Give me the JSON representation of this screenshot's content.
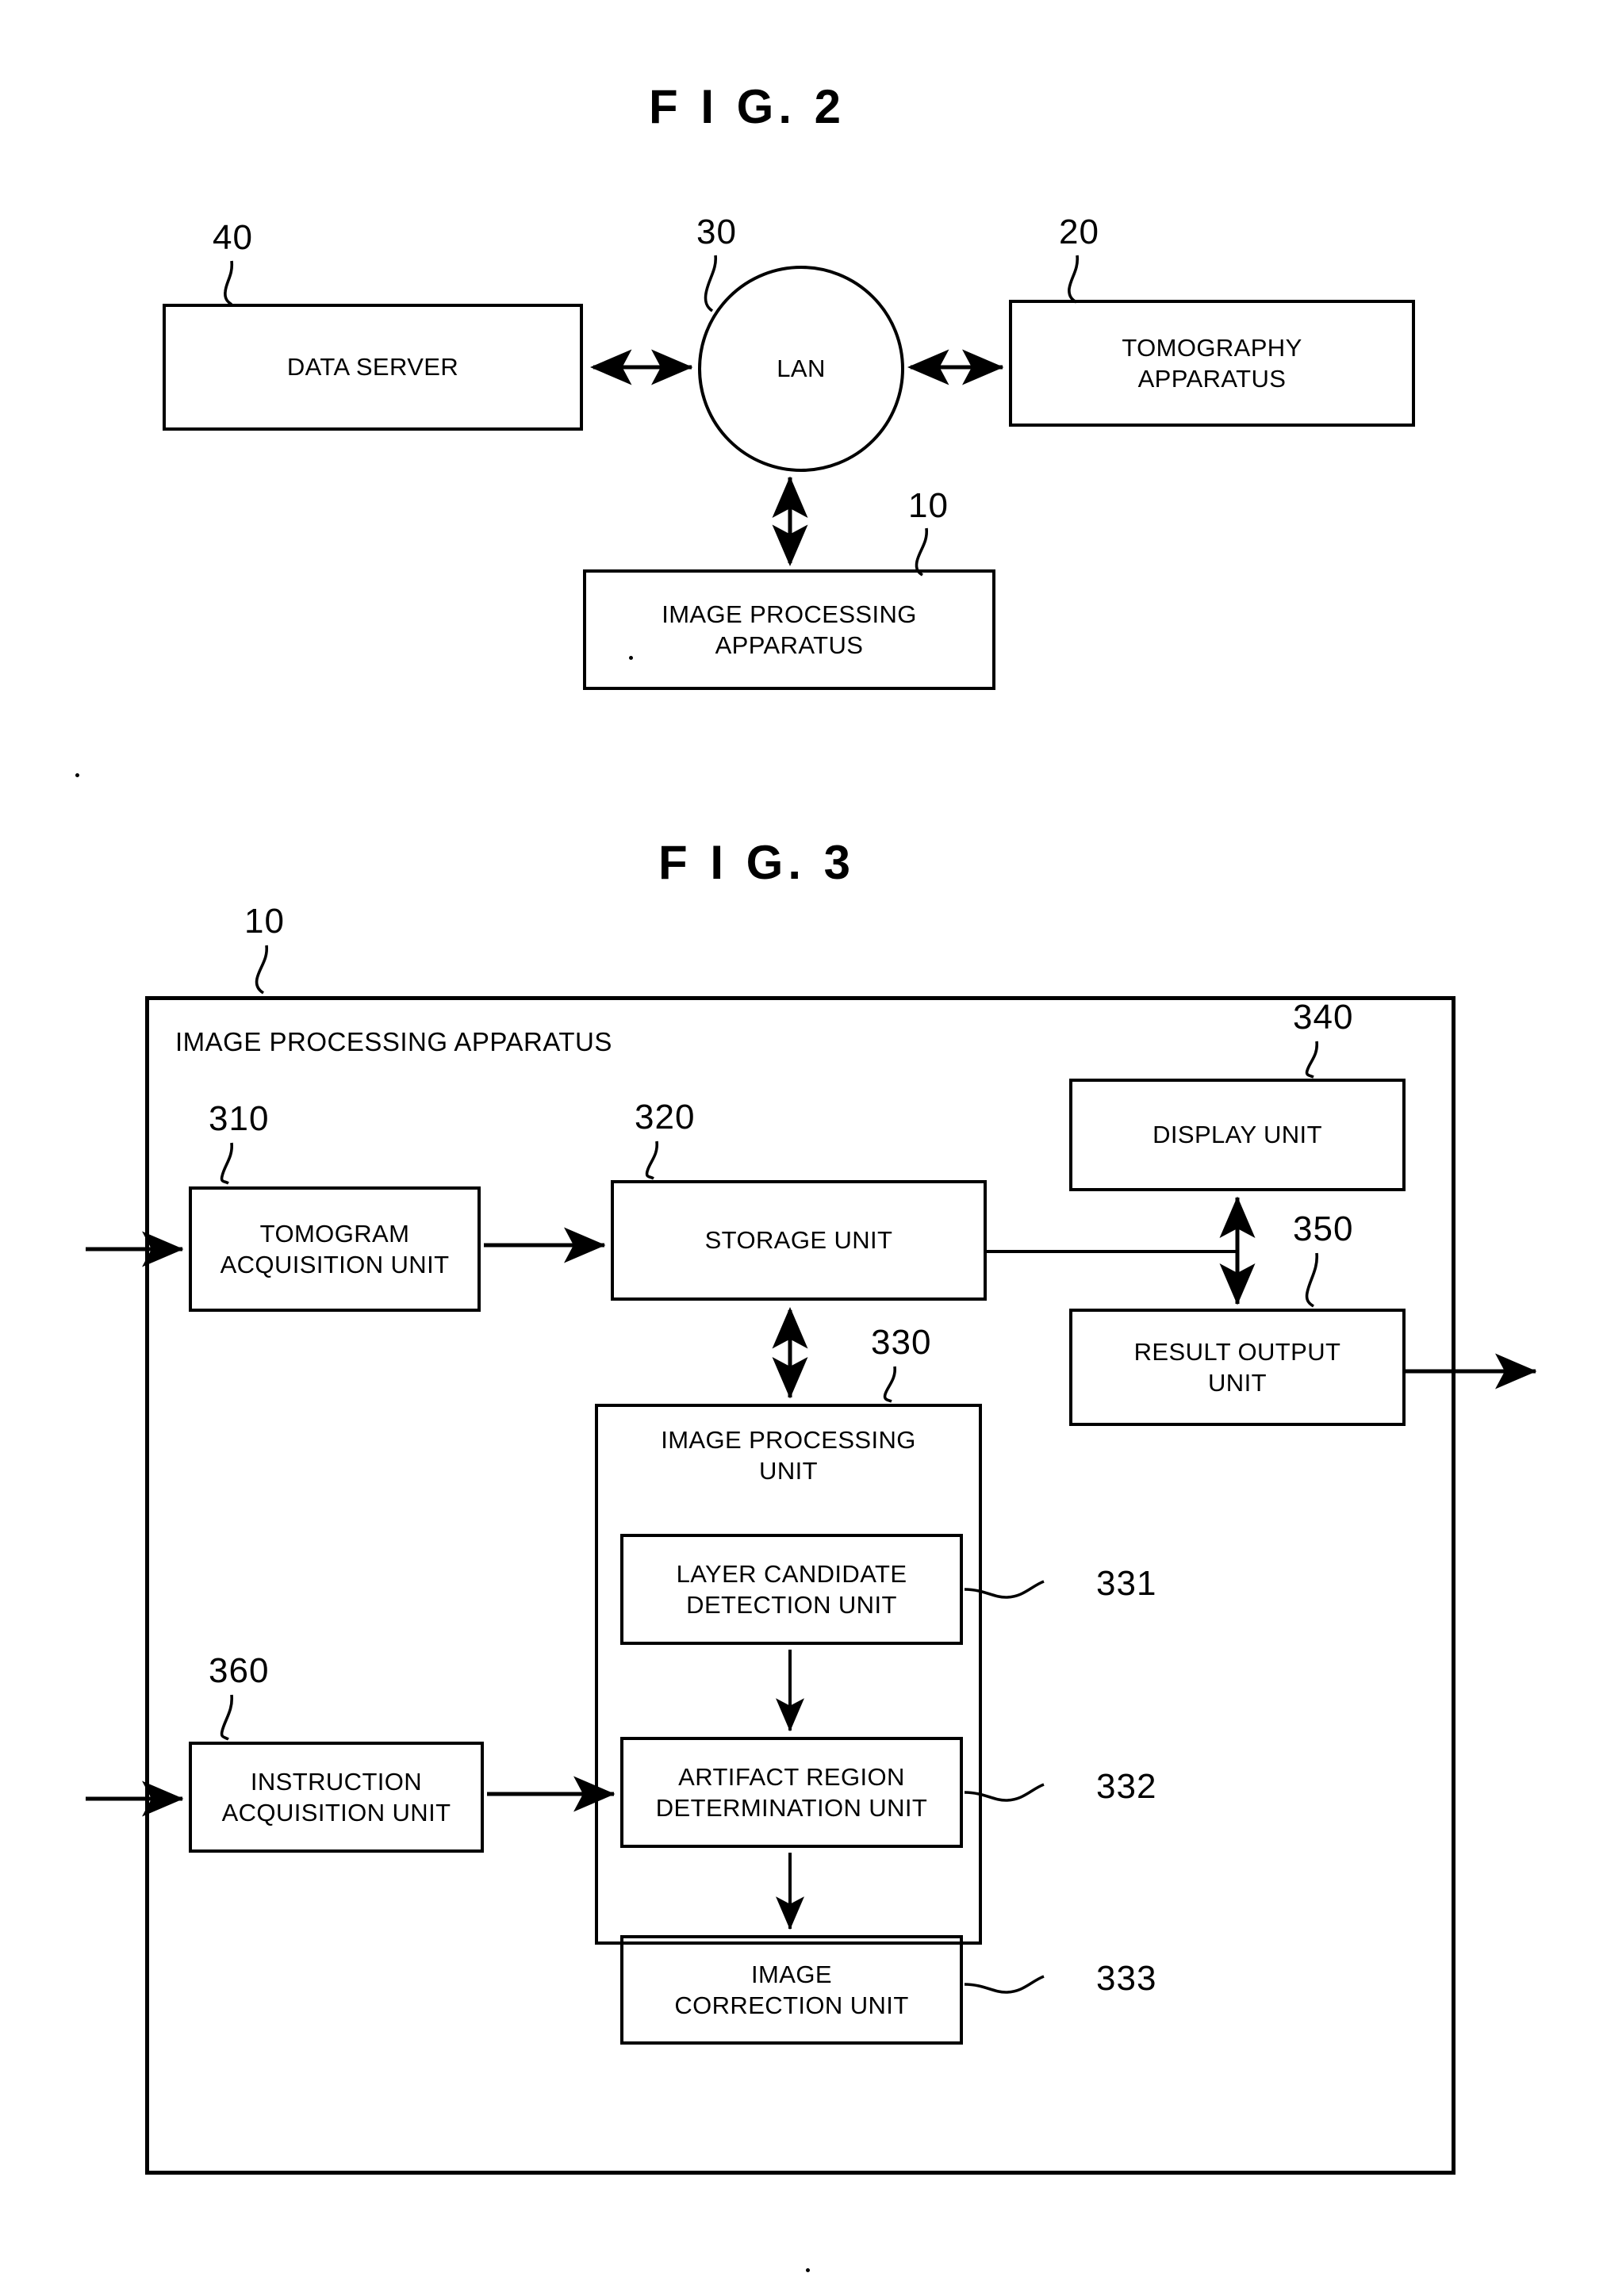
{
  "figures": [
    {
      "id": "fig2",
      "title": "F I G.  2",
      "nodes": [
        {
          "key": "data_server",
          "label": "DATA SERVER",
          "ref": "40"
        },
        {
          "key": "lan",
          "label": "LAN",
          "ref": "30"
        },
        {
          "key": "tomography",
          "label": "TOMOGRAPHY\nAPPARATUS",
          "ref": "20"
        },
        {
          "key": "image_proc",
          "label": "IMAGE PROCESSING\nAPPARATUS",
          "ref": "10"
        }
      ],
      "connections": [
        {
          "from": "data_server",
          "to": "lan",
          "arrow": "double"
        },
        {
          "from": "lan",
          "to": "tomography",
          "arrow": "double"
        },
        {
          "from": "image_proc",
          "to": "lan",
          "arrow": "double"
        }
      ]
    },
    {
      "id": "fig3",
      "title": "F I G.  3",
      "container": {
        "label": "IMAGE PROCESSING APPARATUS",
        "ref": "10"
      },
      "nodes": [
        {
          "key": "tomogram_acq",
          "label": "TOMOGRAM\nACQUISITION UNIT",
          "ref": "310"
        },
        {
          "key": "storage",
          "label": "STORAGE UNIT",
          "ref": "320"
        },
        {
          "key": "display",
          "label": "DISPLAY UNIT",
          "ref": "340"
        },
        {
          "key": "result_output",
          "label": "RESULT OUTPUT\nUNIT",
          "ref": "350"
        },
        {
          "key": "image_proc_unit",
          "label": "IMAGE PROCESSING\nUNIT",
          "ref": "330"
        },
        {
          "key": "layer_cand",
          "label": "LAYER CANDIDATE\nDETECTION UNIT",
          "ref": "331"
        },
        {
          "key": "artifact",
          "label": "ARTIFACT REGION\nDETERMINATION UNIT",
          "ref": "332"
        },
        {
          "key": "img_correction",
          "label": "IMAGE\nCORRECTION UNIT",
          "ref": "333"
        },
        {
          "key": "instruction",
          "label": "INSTRUCTION\nACQUISITION UNIT",
          "ref": "360"
        }
      ],
      "connections": [
        {
          "from": "external",
          "to": "tomogram_acq",
          "arrow": "single"
        },
        {
          "from": "tomogram_acq",
          "to": "storage",
          "arrow": "single"
        },
        {
          "from": "storage",
          "to": "display",
          "arrow": "double"
        },
        {
          "from": "storage",
          "to": "result_output",
          "arrow": "double"
        },
        {
          "from": "storage",
          "to": "image_proc_unit",
          "arrow": "double"
        },
        {
          "from": "result_output",
          "to": "external",
          "arrow": "single"
        },
        {
          "from": "layer_cand",
          "to": "artifact",
          "arrow": "single"
        },
        {
          "from": "artifact",
          "to": "img_correction",
          "arrow": "single"
        },
        {
          "from": "external",
          "to": "instruction",
          "arrow": "single"
        },
        {
          "from": "instruction",
          "to": "artifact",
          "arrow": "single"
        }
      ]
    }
  ],
  "style": {
    "ink": "#000000",
    "paper": "#ffffff"
  }
}
